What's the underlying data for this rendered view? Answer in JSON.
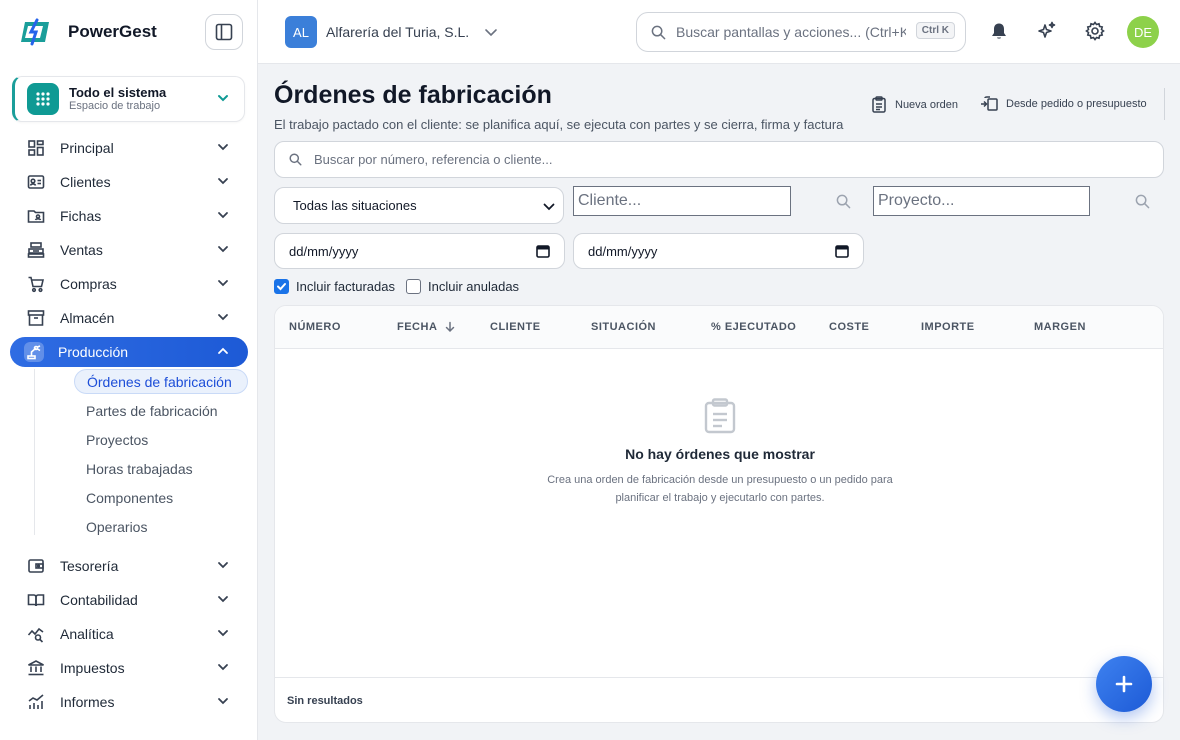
{
  "brand": {
    "name": "PowerGest"
  },
  "workspace": {
    "title": "Todo el sistema",
    "subtitle": "Espacio de trabajo"
  },
  "sidebar": {
    "items": [
      {
        "label": "Principal",
        "icon": "dashboard-icon"
      },
      {
        "label": "Clientes",
        "icon": "contact-card-icon"
      },
      {
        "label": "Fichas",
        "icon": "folder-user-icon"
      },
      {
        "label": "Ventas",
        "icon": "cash-register-icon"
      },
      {
        "label": "Compras",
        "icon": "cart-icon"
      },
      {
        "label": "Almacén",
        "icon": "archive-box-icon"
      },
      {
        "label": "Producción",
        "icon": "robot-arm-icon",
        "active": true
      },
      {
        "label": "Tesorería",
        "icon": "wallet-icon"
      },
      {
        "label": "Contabilidad",
        "icon": "book-open-icon"
      },
      {
        "label": "Analítica",
        "icon": "chart-search-icon"
      },
      {
        "label": "Impuestos",
        "icon": "bank-icon"
      },
      {
        "label": "Informes",
        "icon": "bar-trend-icon"
      }
    ],
    "production_sub": [
      "Órdenes de fabricación",
      "Partes de fabricación",
      "Proyectos",
      "Horas trabajadas",
      "Componentes",
      "Operarios"
    ]
  },
  "topbar": {
    "company_initials": "AL",
    "company_name": "Alfarería del Turia, S.L.",
    "search_placeholder": "Buscar pantallas y acciones... (Ctrl+K)",
    "search_shortcut": "Ctrl K",
    "user_initials": "DE"
  },
  "page": {
    "title": "Órdenes de fabricación",
    "subtitle": "El trabajo pactado con el cliente: se planifica aquí, se ejecuta con partes y se cierra, firma y factura",
    "action_new": "Nueva orden",
    "action_from": "Desde pedido o presupuesto"
  },
  "filters": {
    "search_placeholder": "Buscar por número, referencia o cliente...",
    "status_selected": "Todas las situaciones",
    "client_placeholder": "Cliente...",
    "project_placeholder": "Proyecto...",
    "date_from": "dd/mm/yyyy",
    "date_to": "dd/mm/yyyy",
    "include_invoiced": "Incluir facturadas",
    "include_invoiced_checked": true,
    "include_cancelled": "Incluir anuladas",
    "include_cancelled_checked": false
  },
  "table": {
    "columns": [
      "NÚMERO",
      "FECHA",
      "CLIENTE",
      "SITUACIÓN",
      "% EJECUTADO",
      "COSTE",
      "IMPORTE",
      "MARGEN"
    ],
    "rows": [],
    "empty_title": "No hay órdenes que mostrar",
    "empty_desc": "Crea una orden de fabricación desde un presupuesto o un pedido para planificar el trabajo y ejecutarlo con partes.",
    "footer": "Sin resultados"
  },
  "colors": {
    "accent": "#1d5ad6",
    "brand_teal": "#0f9a94",
    "avatar": "#8dd14a"
  }
}
